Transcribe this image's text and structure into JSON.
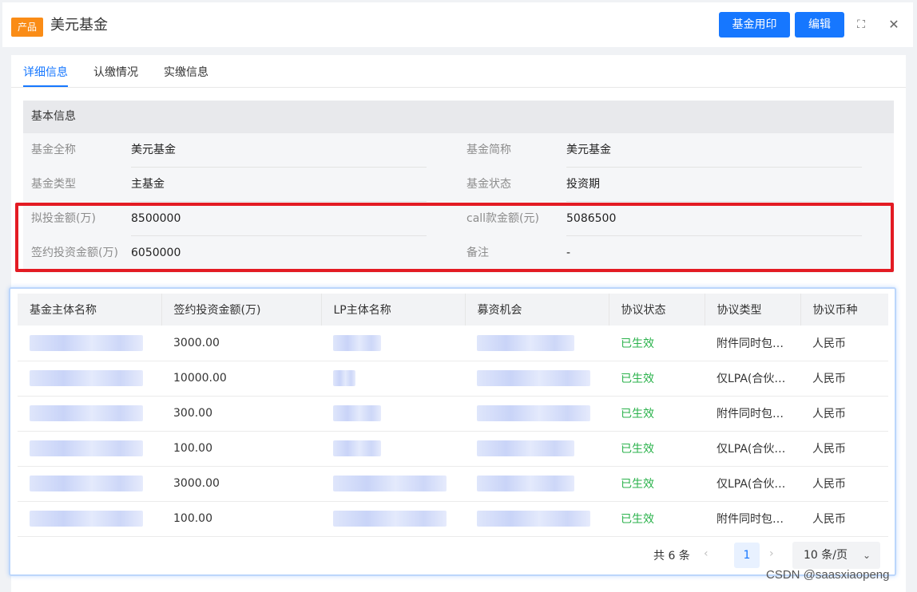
{
  "header": {
    "tag": "产品",
    "title": "美元基金",
    "print_label": "基金用印",
    "edit_label": "编辑",
    "expand_icon": "⛶",
    "close_icon": "✕"
  },
  "tabs": [
    {
      "label": "详细信息",
      "active": true
    },
    {
      "label": "认缴情况",
      "active": false
    },
    {
      "label": "实缴信息",
      "active": false
    }
  ],
  "section": {
    "title": "基本信息"
  },
  "info": [
    {
      "label": "基金全称",
      "value": "美元基金"
    },
    {
      "label": "基金简称",
      "value": "美元基金"
    },
    {
      "label": "基金类型",
      "value": "主基金"
    },
    {
      "label": "基金状态",
      "value": "投资期"
    },
    {
      "label": "拟投金额(万)",
      "value": "8500000"
    },
    {
      "label": "call款金额(元)",
      "value": "5086500"
    },
    {
      "label": "签约投资金额(万)",
      "value": "6050000"
    },
    {
      "label": "备注",
      "value": "-"
    }
  ],
  "table": {
    "headers": [
      "基金主体名称",
      "签约投资金额(万)",
      "LP主体名称",
      "募资机会",
      "协议状态",
      "协议类型",
      "协议币种"
    ],
    "rows": [
      {
        "amount": "3000.00",
        "status": "已生效",
        "type": "附件同时包…",
        "currency": "人民币"
      },
      {
        "amount": "10000.00",
        "status": "已生效",
        "type": "仅LPA(合伙…",
        "currency": "人民币"
      },
      {
        "amount": "300.00",
        "status": "已生效",
        "type": "附件同时包…",
        "currency": "人民币"
      },
      {
        "amount": "100.00",
        "status": "已生效",
        "type": "仅LPA(合伙…",
        "currency": "人民币"
      },
      {
        "amount": "3000.00",
        "status": "已生效",
        "type": "仅LPA(合伙…",
        "currency": "人民币"
      },
      {
        "amount": "100.00",
        "status": "已生效",
        "type": "附件同时包…",
        "currency": "人民币"
      }
    ]
  },
  "pagination": {
    "total": "共 6 条",
    "page": "1",
    "prev_icon": "‹",
    "next_icon": "›",
    "page_size": "10 条/页",
    "chevron_icon": "⌄"
  },
  "watermark": "CSDN @saasxiaopeng",
  "colors": {
    "primary": "#1677ff",
    "tag": "#fa8c16",
    "success": "#2ab24b",
    "highlight": "#e31b23"
  }
}
